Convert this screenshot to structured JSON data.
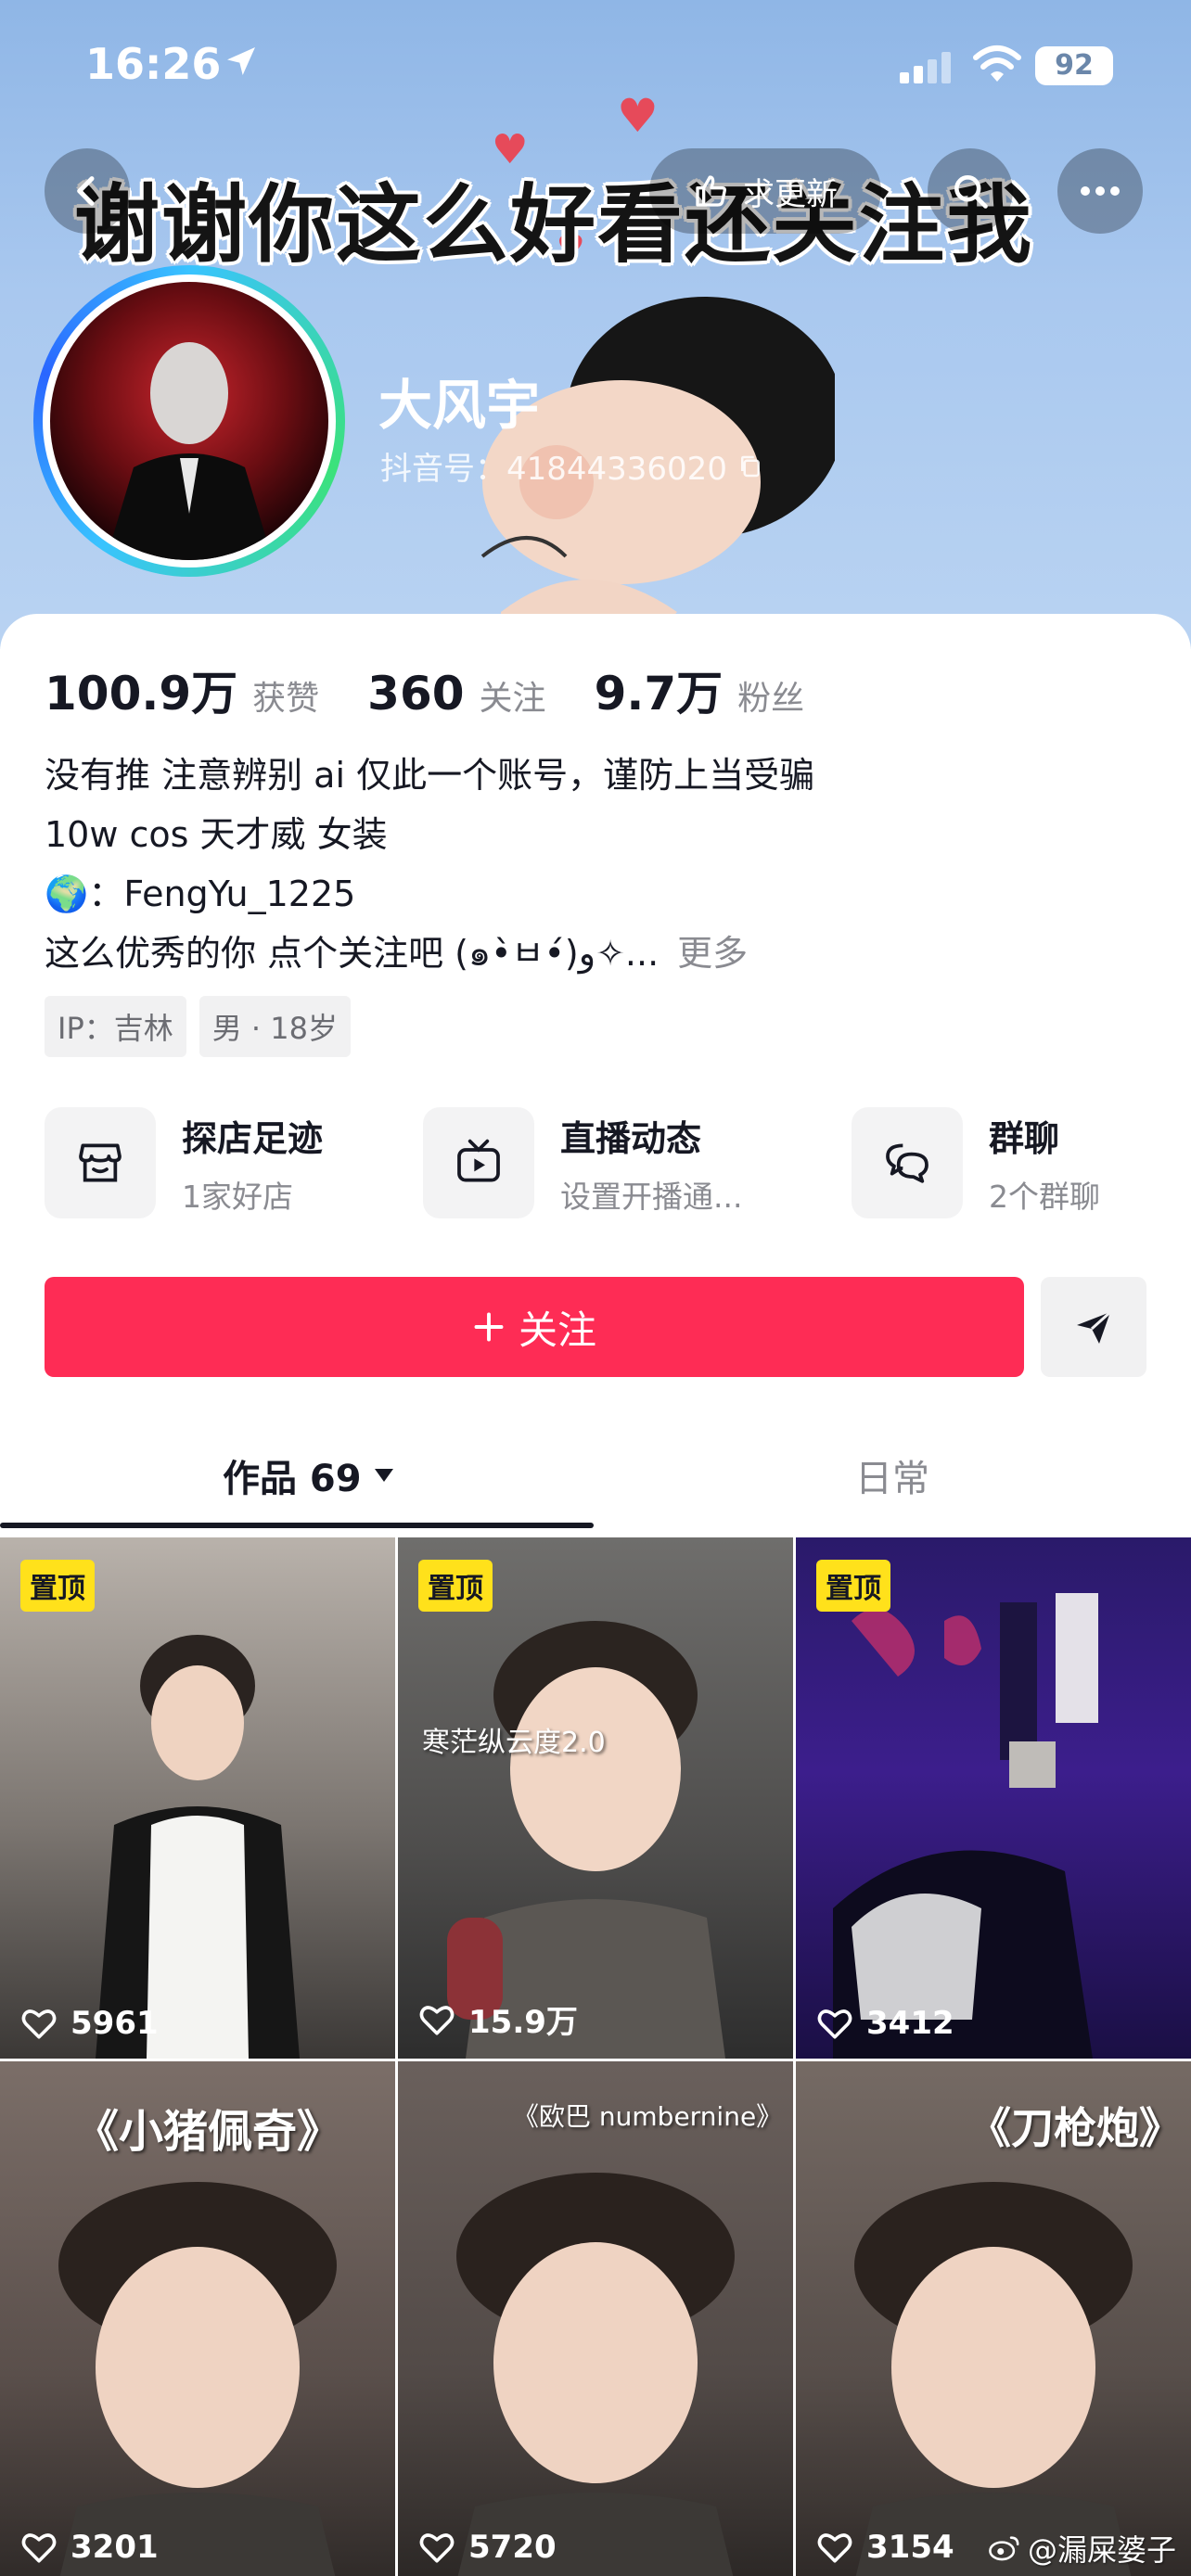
{
  "status_bar": {
    "time": "16:26",
    "battery": "92"
  },
  "nav": {
    "update_label": "求更新"
  },
  "banner": {
    "caption": "谢谢你这么好看还关注我"
  },
  "profile": {
    "name": "大风宇",
    "douyin_id": "抖音号：41844336020"
  },
  "stats": [
    {
      "value": "100.9万",
      "label": "获赞"
    },
    {
      "value": "360",
      "label": "关注"
    },
    {
      "value": "9.7万",
      "label": "粉丝"
    }
  ],
  "bio": {
    "line1": "没有推 注意辨别 ai 仅此一个账号，谨防上当受骗",
    "line2": "10w cos 天才威 女装",
    "line3": "🌍：FengYu_1225",
    "line4": " 这么优秀的你 点个关注吧 (๑•̀ㅂ•́)و✧...",
    "more": "更多"
  },
  "tags": [
    "IP：吉林",
    "男 · 18岁"
  ],
  "features": [
    {
      "title": "探店足迹",
      "sub": "1家好店"
    },
    {
      "title": "直播动态",
      "sub": "设置开播通..."
    },
    {
      "title": "群聊",
      "sub": "2个群聊"
    }
  ],
  "actions": {
    "follow": "关注"
  },
  "tabs": {
    "works": "作品 69",
    "daily": "日常"
  },
  "videos": [
    {
      "pinned": "置顶",
      "likes": "5961"
    },
    {
      "pinned": "置顶",
      "likes": "15.9万",
      "title": "寒茫纵云度2.0"
    },
    {
      "pinned": "置顶",
      "likes": "3412"
    },
    {
      "likes": "3201",
      "title": "《小猪佩奇》"
    },
    {
      "likes": "5720",
      "title": "《欧巴 numbernine》"
    },
    {
      "likes": "3154",
      "title": "《刀枪炮》"
    }
  ],
  "watermark": "@漏屎婆子",
  "colors": {
    "accent": "#fe2c55",
    "pin": "#ffe11b"
  }
}
